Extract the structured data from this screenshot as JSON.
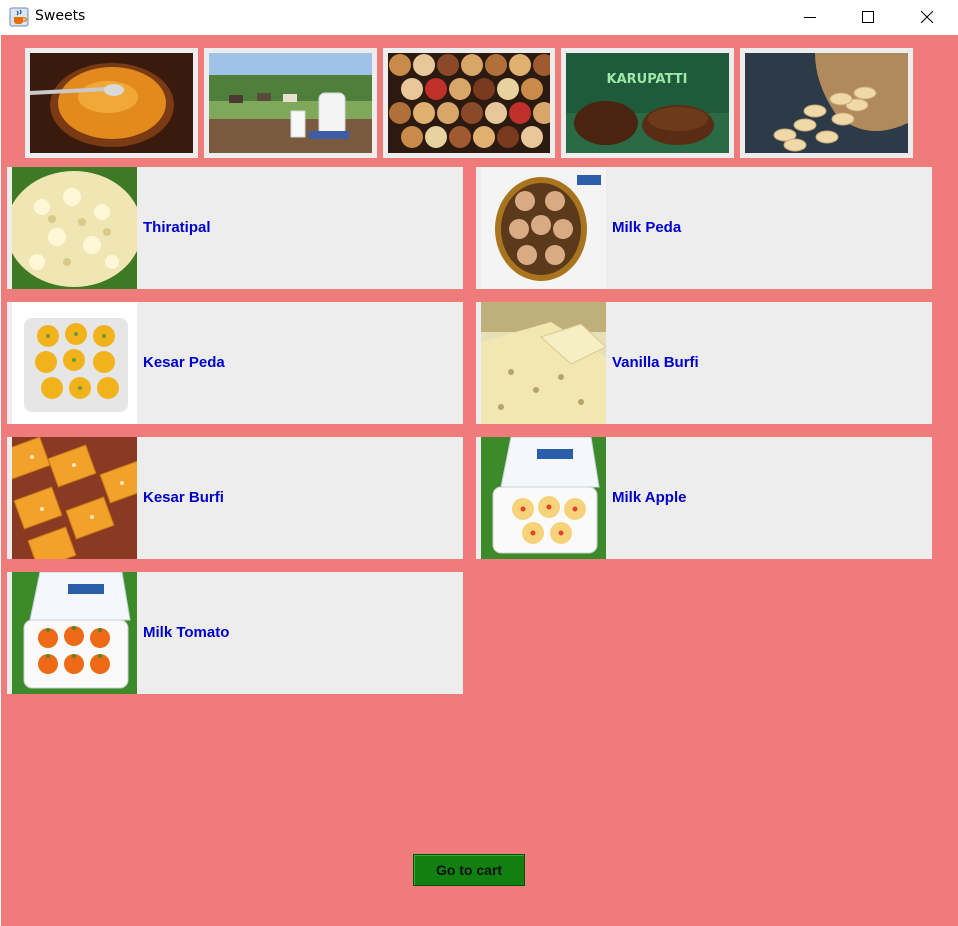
{
  "window": {
    "title": "Sweets",
    "icon": "java-cup-icon",
    "controls": [
      "minimize-icon",
      "maximize-icon",
      "close-icon"
    ]
  },
  "colors": {
    "background": "#f07b7b",
    "card": "#ededed",
    "item_text": "#0000cc",
    "cart_button": "#118011"
  },
  "banners": [
    {
      "subject": "ghee"
    },
    {
      "subject": "milk"
    },
    {
      "subject": "dry fruits"
    },
    {
      "subject": "karupatti",
      "caption": "KARUPATTI"
    },
    {
      "subject": "cashews"
    }
  ],
  "items": [
    {
      "name": "Thiratipal"
    },
    {
      "name": "Milk Peda"
    },
    {
      "name": "Kesar Peda"
    },
    {
      "name": "Vanilla Burfi"
    },
    {
      "name": "Kesar Burfi"
    },
    {
      "name": "Milk Apple"
    },
    {
      "name": "Milk Tomato"
    }
  ],
  "cart_button": {
    "label": "Go to cart"
  }
}
